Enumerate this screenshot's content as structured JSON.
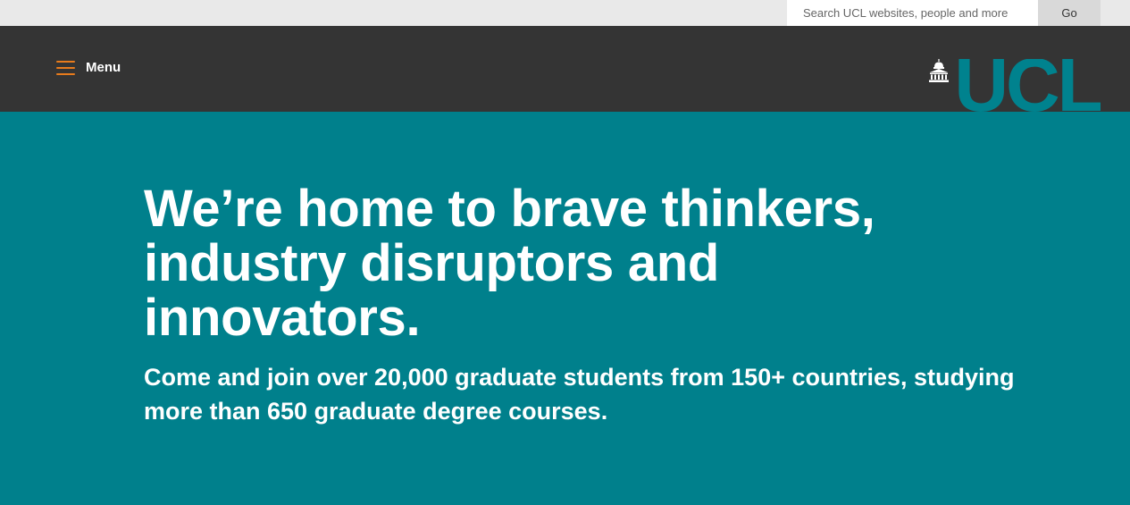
{
  "search": {
    "placeholder": "Search UCL websites, people and more",
    "value": "",
    "go_label": "Go"
  },
  "header": {
    "menu_label": "Menu",
    "logo_text": "UCL",
    "logo_icon": "portico-icon",
    "menu_icon": "hamburger-icon"
  },
  "hero": {
    "headline": "We’re home to brave thinkers, industry disruptors and innovators.",
    "subheadline": "Come and join over 20,000 graduate students from 150+ countries, studying more than 650 graduate degree courses."
  },
  "colors": {
    "topbar": "#e9e9e9",
    "header": "#343434",
    "hero": "#00808c",
    "logo": "#00828e",
    "menu_accent": "#e87b1c"
  }
}
